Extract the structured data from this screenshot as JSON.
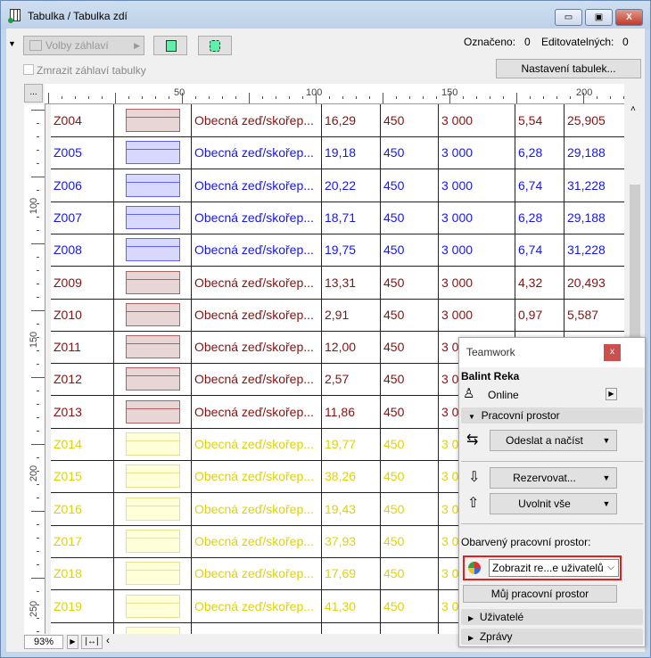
{
  "window": {
    "title": "Tabulka /  Tabulka zdí",
    "minimize": "▭",
    "maximize": "▣",
    "close": "X"
  },
  "toolbar": {
    "header_options": "Volby záhlaví",
    "marked_label": "Označeno:",
    "marked_value": "0",
    "editable_label": "Editovatelných:",
    "editable_value": "0",
    "freeze_header": "Zmrazit záhlaví tabulky",
    "settings_button": "Nastavení tabulek...",
    "more_button": "..."
  },
  "ruler": {
    "top": [
      "50",
      "100",
      "150",
      "200"
    ],
    "left": [
      "100",
      "150",
      "200",
      "250"
    ]
  },
  "colors": {
    "red": "#8b1010",
    "blue": "#1414ff",
    "yellow": "#e0d400"
  },
  "rows": [
    {
      "id": "Z004",
      "name": "Obecná zeď/skořep...",
      "c3": "16,29",
      "c4": "450",
      "c5": "3 000",
      "c6": "5,54",
      "c7": "25,905",
      "color": "red"
    },
    {
      "id": "Z005",
      "name": "Obecná zeď/skořep...",
      "c3": "19,18",
      "c4": "450",
      "c5": "3 000",
      "c6": "6,28",
      "c7": "29,188",
      "color": "blue"
    },
    {
      "id": "Z006",
      "name": "Obecná zeď/skořep...",
      "c3": "20,22",
      "c4": "450",
      "c5": "3 000",
      "c6": "6,74",
      "c7": "31,228",
      "color": "blue"
    },
    {
      "id": "Z007",
      "name": "Obecná zeď/skořep...",
      "c3": "18,71",
      "c4": "450",
      "c5": "3 000",
      "c6": "6,28",
      "c7": "29,188",
      "color": "blue"
    },
    {
      "id": "Z008",
      "name": "Obecná zeď/skořep...",
      "c3": "19,75",
      "c4": "450",
      "c5": "3 000",
      "c6": "6,74",
      "c7": "31,228",
      "color": "blue"
    },
    {
      "id": "Z009",
      "name": "Obecná zeď/skořep...",
      "c3": "13,31",
      "c4": "450",
      "c5": "3 000",
      "c6": "4,32",
      "c7": "20,493",
      "color": "red"
    },
    {
      "id": "Z010",
      "name": "Obecná zeď/skořep...",
      "c3": "2,91",
      "c4": "450",
      "c5": "3 000",
      "c6": "0,97",
      "c7": "5,587",
      "color": "red"
    },
    {
      "id": "Z011",
      "name": "Obecná zeď/skořep...",
      "c3": "12,00",
      "c4": "450",
      "c5": "3 0",
      "c6": "",
      "c7": "",
      "color": "red"
    },
    {
      "id": "Z012",
      "name": "Obecná zeď/skořep...",
      "c3": "2,57",
      "c4": "450",
      "c5": "3 0",
      "c6": "",
      "c7": "",
      "color": "red"
    },
    {
      "id": "Z013",
      "name": "Obecná zeď/skořep...",
      "c3": "11,86",
      "c4": "450",
      "c5": "3 0",
      "c6": "",
      "c7": "",
      "color": "red"
    },
    {
      "id": "Z014",
      "name": "Obecná zeď/skořep...",
      "c3": "19,77",
      "c4": "450",
      "c5": "3 0",
      "c6": "",
      "c7": "",
      "color": "yellow"
    },
    {
      "id": "Z015",
      "name": "Obecná zeď/skořep...",
      "c3": "38,26",
      "c4": "450",
      "c5": "3 0",
      "c6": "",
      "c7": "",
      "color": "yellow"
    },
    {
      "id": "Z016",
      "name": "Obecná zeď/skořep...",
      "c3": "19,43",
      "c4": "450",
      "c5": "3 0",
      "c6": "",
      "c7": "",
      "color": "yellow"
    },
    {
      "id": "Z017",
      "name": "Obecná zeď/skořep...",
      "c3": "37,93",
      "c4": "450",
      "c5": "3 0",
      "c6": "",
      "c7": "",
      "color": "yellow"
    },
    {
      "id": "Z018",
      "name": "Obecná zeď/skořep...",
      "c3": "17,69",
      "c4": "450",
      "c5": "3 0",
      "c6": "",
      "c7": "",
      "color": "yellow"
    },
    {
      "id": "Z019",
      "name": "Obecná zeď/skořep...",
      "c3": "41,30",
      "c4": "450",
      "c5": "3 0",
      "c6": "",
      "c7": "",
      "color": "yellow"
    },
    {
      "id": "",
      "name": "",
      "c3": "",
      "c4": "",
      "c5": "",
      "c6": "",
      "c7": "",
      "color": "yellow"
    }
  ],
  "bottom": {
    "zoom": "93%"
  },
  "teamwork": {
    "title": "Teamwork",
    "close": "x",
    "user": "Balint Reka",
    "status": "Online",
    "workspace_section": "Pracovní prostor",
    "send_receive": "Odeslat a načíst",
    "reserve": "Rezervovat...",
    "release_all": "Uvolnit vše",
    "colored_label": "Obarvený pracovní prostor:",
    "colored_select": "Zobrazit re...e uživatelů",
    "my_workspace": "Můj pracovní prostor",
    "users_section": "Uživatelé",
    "messages_section": "Zprávy"
  }
}
